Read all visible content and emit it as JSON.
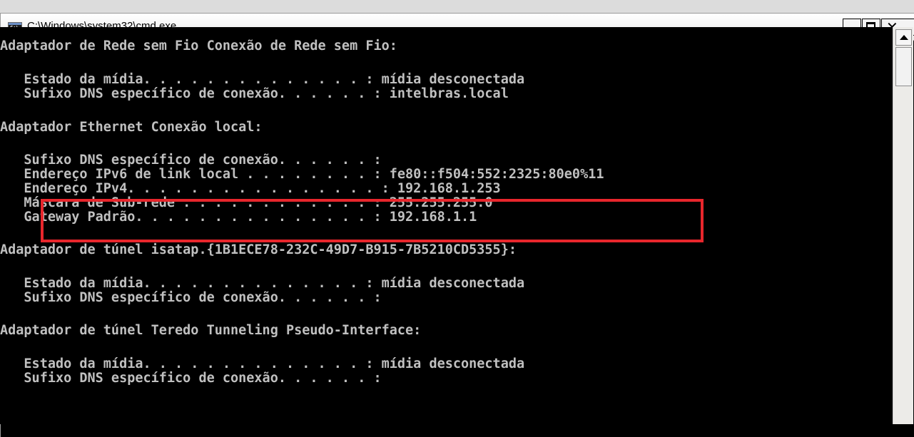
{
  "window": {
    "title": "C:\\Windows\\system32\\cmd.exe",
    "icon": "cmd-icon",
    "controls": {
      "minimize": "minimize-icon",
      "maximize": "maximize-icon",
      "close": "close-icon"
    }
  },
  "console": {
    "lines": [
      "Adaptador de Rede sem Fio Conexão de Rede sem Fio:",
      "   Estado da mídia. . . . . . . . . . . . . . : mídia desconectada",
      "   Sufixo DNS específico de conexão. . . . . . : intelbras.local",
      "Adaptador Ethernet Conexão local:",
      "   Sufixo DNS específico de conexão. . . . . . :",
      "   Endereço IPv6 de link local . . . . . . . . : fe80::f504:552:2325:80e0%11",
      "   Endereço IPv4. . . . . . . . . . . . . . . . : 192.168.1.253",
      "   Máscara de Sub-rede . . . . . . . . . . . . : 255.255.255.0",
      "   Gateway Padrão. . . . . . . . . . . . . . . : 192.168.1.1",
      "Adaptador de túnel isatap.{1B1ECE78-232C-49D7-B915-7B5210CD5355}:",
      "   Estado da mídia. . . . . . . . . . . . . . : mídia desconectada",
      "   Sufixo DNS específico de conexão. . . . . . :",
      "Adaptador de túnel Teredo Tunneling Pseudo-Interface:",
      "   Estado da mídia. . . . . . . . . . . . . . : mídia desconectada",
      "   Sufixo DNS específico de conexão. . . . . . :"
    ]
  },
  "colors": {
    "console_bg": "#000000",
    "console_text": "#c0c0c0",
    "highlight_border": "#e8262c"
  }
}
